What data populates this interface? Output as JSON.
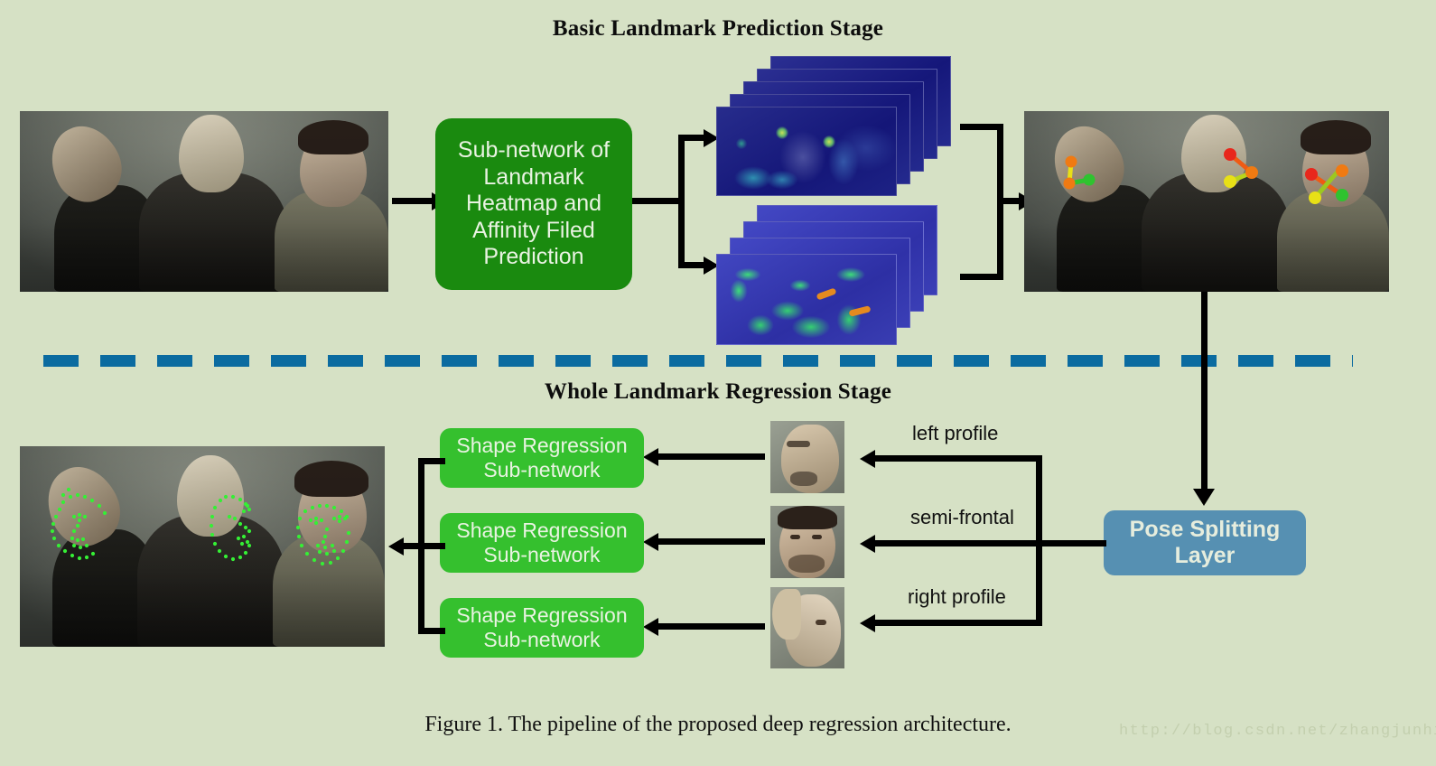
{
  "stages": {
    "basic_title": "Basic Landmark Prediction Stage",
    "whole_title": "Whole Landmark Regression Stage"
  },
  "boxes": {
    "subnetwork": "Sub-network of Landmark Heatmap and Affinity Filed Prediction",
    "subnetwork_lines": [
      "Sub-network of",
      "Landmark",
      "Heatmap and",
      "Affinity Filed",
      "Prediction"
    ],
    "shape_regression": "Shape Regression Sub-network",
    "shape_regression_lines": [
      "Shape Regression",
      "Sub-network"
    ],
    "pose_splitting": "Pose Splitting Layer",
    "pose_splitting_lines": [
      "Pose Splitting",
      "Layer"
    ]
  },
  "branch_labels": {
    "left_profile": "left profile",
    "semi_frontal": "semi-frontal",
    "right_profile": "right profile"
  },
  "images": {
    "input_photo": "three-people-group-portrait",
    "heatmap_stack": "landmark-heatmap-stack",
    "affinity_stack": "affinity-field-stack",
    "basic_landmark_result": "faces-with-basic-landmarks",
    "final_result": "faces-with-dense-landmarks",
    "crop_left": "left-profile-face-crop",
    "crop_semi": "semi-frontal-face-crop",
    "crop_right": "right-profile-face-crop"
  },
  "caption": "Figure 1. The pipeline of the proposed deep regression architecture.",
  "watermark": "http://blog.csdn.net/zhangjunhit",
  "colors": {
    "background": "#d6e1c5",
    "subnetwork_green": "#1a8a0f",
    "shape_regression_green": "#35c02e",
    "pose_layer_blue": "#5690b2",
    "divider_blue": "#0b6ba0",
    "landmark_green": "#35ef35",
    "landmark_red": "#e8271c",
    "landmark_orange": "#f07a12",
    "landmark_yellow": "#e8e016",
    "heatmap_base": "#1b1f7a",
    "arrow_black": "#000000"
  }
}
